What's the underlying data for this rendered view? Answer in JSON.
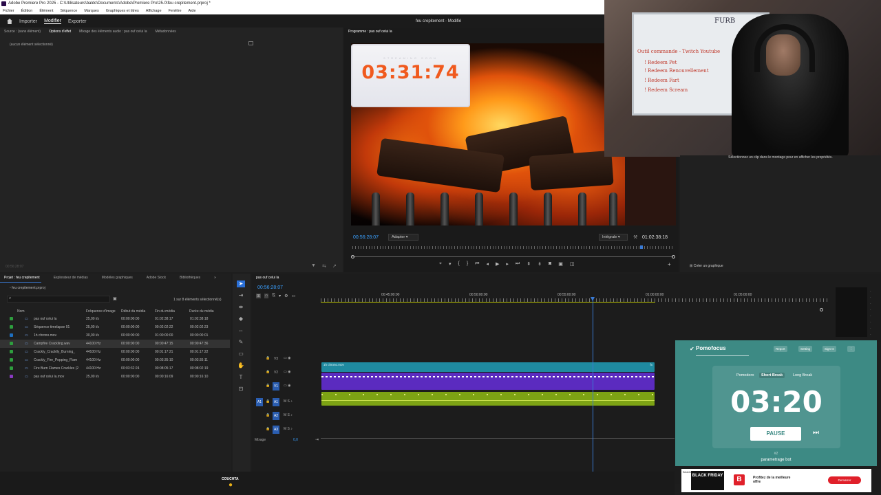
{
  "window": {
    "title": "Adobe Premiere Pro 2025 - C:\\Utilisateurs\\baldo\\Documents\\Adobe\\Premiere Pro\\25.0\\feu crepitement.prproj *"
  },
  "menu": [
    "Fichier",
    "Édition",
    "Élément",
    "Séquence",
    "Marques",
    "Graphiques et titres",
    "Affichage",
    "Fenêtre",
    "Aide"
  ],
  "nav": {
    "tabs": [
      "Importer",
      "Modifier",
      "Exporter"
    ],
    "active": "Modifier",
    "center_title": "feu crepitement",
    "center_status": "Modifié"
  },
  "source_panel": {
    "tabs": [
      "Source : (sans élément)",
      "Options d'effet",
      "Mixage des éléments audio : pas ouf celui la",
      "Métadonnées"
    ],
    "empty": "(aucun élément sélectionné)",
    "timecode": "00:56:28:07"
  },
  "program": {
    "tab": "Programme : pas ouf celui la",
    "timecode": "00:56:28:07",
    "fit": "Adapter",
    "quality": "Intégrale",
    "duration": "01:02:38:18"
  },
  "overlay_timer": {
    "caption": "STREAMING SOON",
    "value": "03:31:74"
  },
  "whiteboard": {
    "lines": [
      "Outil commande - Twitch Youtube",
      "! Redeem Pet",
      "! Redeem Renouvellement",
      "! Redeem Fart",
      "! Redeem Scream"
    ],
    "corner": "FURB"
  },
  "properties": {
    "message": "Sélectionnez un clip dans le montage pour en afficher les propriétés.",
    "create_graphic": "Créer un graphique"
  },
  "project": {
    "tabs": [
      "Projet : feu crepitement",
      "Explorateur de médias",
      "Modèles graphiques",
      "Adobe Stock",
      "Bibliothèques"
    ],
    "file": "feu crepitement.prproj",
    "count": "1 sur 8 éléments sélectionné(s)",
    "columns": [
      "Nom",
      "Fréquence d'image",
      "Début du média",
      "Fin du média",
      "Durée du média"
    ],
    "rows": [
      {
        "name": "pas ouf celui la",
        "fps": "25,00 i/s",
        "start": "00:00:00:00",
        "end": "01:02:38:17",
        "dur": "01:02:38:18",
        "color": "#2e9e3e"
      },
      {
        "name": "Séquence timelapse 01",
        "fps": "25,00 i/s",
        "start": "00:00:00:00",
        "end": "00:02:02:22",
        "dur": "00:02:02:23",
        "color": "#2e9e3e"
      },
      {
        "name": "1h chrono.mov",
        "fps": "30,00 i/s",
        "start": "00:00:00:00",
        "end": "01:00:00:00",
        "dur": "00:00:00:01",
        "color": "#1e6fbf"
      },
      {
        "name": "Campfire Crackling.wav",
        "fps": "44100 Hz",
        "start": "00:00:00:00",
        "end": "00:00:47:15",
        "dur": "00:00:47:36",
        "color": "#2e9e3e"
      },
      {
        "name": "Crackly_Cracklly_Burning_",
        "fps": "44100 Hz",
        "start": "00:00:00:00",
        "end": "00:01:17:21",
        "dur": "00:01:17:22",
        "color": "#2e9e3e"
      },
      {
        "name": "Crackly_Fire_Popping_Flam",
        "fps": "44100 Hz",
        "start": "00:00:00:00",
        "end": "00:03:35:10",
        "dur": "00:03:35:11",
        "color": "#2e9e3e"
      },
      {
        "name": "Fire Burn Flames Crackles (2",
        "fps": "44100 Hz",
        "start": "00:03:32:24",
        "end": "00:08:05:17",
        "dur": "00:08:02:19",
        "color": "#2e9e3e"
      },
      {
        "name": "pas ouf celui la.mov",
        "fps": "25,00 i/s",
        "start": "00:00:00:00",
        "end": "00:00:16:09",
        "dur": "00:00:16:10",
        "color": "#8a3ac0"
      }
    ]
  },
  "timeline": {
    "tab": "pas ouf celui la",
    "timecode": "00:56:28:07",
    "ruler": [
      "00:45:00:00",
      "00:50:00:00",
      "00:55:00:00",
      "01:00:00:00",
      "01:05:00:00"
    ],
    "tracks": [
      "V3",
      "V2",
      "V1",
      "A1",
      "A2",
      "A3"
    ],
    "clip_v2": "1h chrono.mov",
    "clip_fx": "fx",
    "mix_label": "Mixage",
    "mix_value": "0,0"
  },
  "pomofocus": {
    "brand": "Pomofocus",
    "report": "Report",
    "setting": "Setting",
    "signin": "Sign In",
    "modes": [
      "Pomodoro",
      "Short Break",
      "Long Break"
    ],
    "active_mode": "Short Break",
    "time": "03:20",
    "pause": "PAUSE",
    "counter": "#2",
    "task": "parametrage bot"
  },
  "ad": {
    "brand": "Bitdefender",
    "badge": "BLACK FRIDAY",
    "text": "Profitez de la meilleure offre",
    "cta": "Demarrer"
  },
  "watermark": "COUCHTA",
  "colors": {
    "accent": "#3a7bd5",
    "pomo": "#3d8a84",
    "v1": "#5b2bbf",
    "audio": "#8dbf1a",
    "video_clip": "#2aa3b5"
  }
}
